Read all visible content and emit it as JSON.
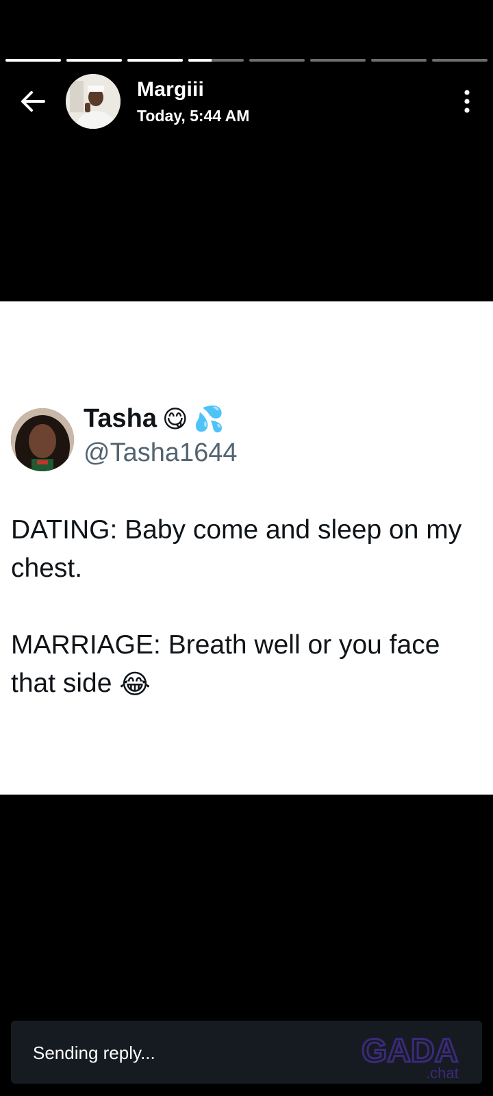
{
  "status": {
    "segments_total": 8,
    "segments_complete": 3,
    "current_progress": 0.42
  },
  "header": {
    "name": "Margiii",
    "time": "Today, 5:44 AM",
    "back_icon": "arrow-left-icon",
    "menu_icon": "more-vertical-icon"
  },
  "tweet": {
    "display_name": "Tasha",
    "name_emojis": [
      "😋",
      "💦"
    ],
    "handle": "@Tasha1644",
    "line1": "DATING: Baby come and sleep on my chest.",
    "line2": "MARRIAGE: Breath well or you face that side",
    "line2_emoji": "😂"
  },
  "reply": {
    "status_text": "Sending reply..."
  },
  "watermark": {
    "text": "GADA",
    "suffix": ".chat"
  },
  "colors": {
    "background": "#000000",
    "card": "#ffffff",
    "handle": "#536471",
    "reply_bar": "#161b22",
    "watermark": "#3b2a7a"
  }
}
